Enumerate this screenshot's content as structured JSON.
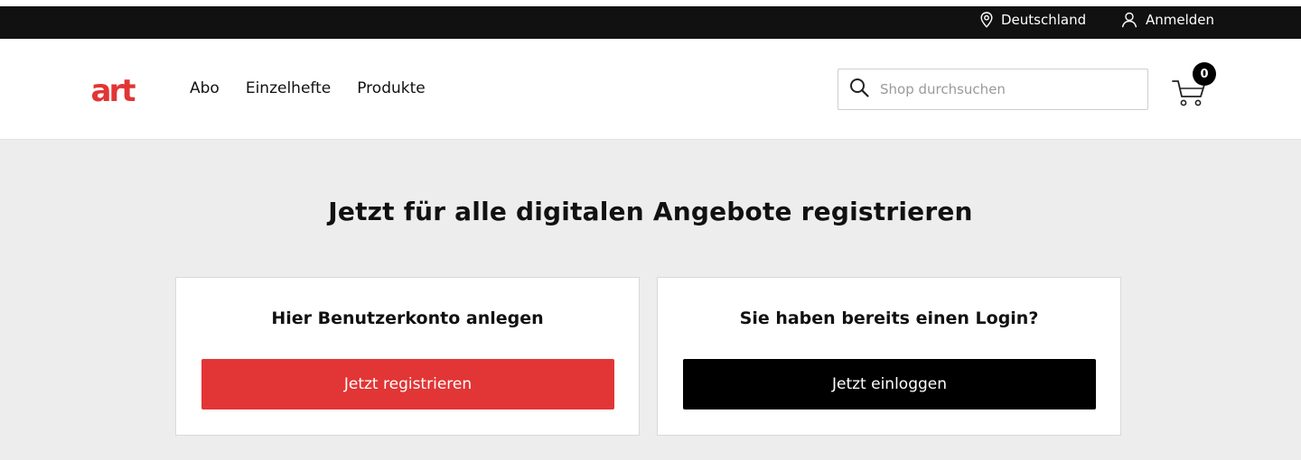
{
  "topbar": {
    "location_label": "Deutschland",
    "login_label": "Anmelden"
  },
  "header": {
    "logo_text": "art",
    "nav": [
      "Abo",
      "Einzelhefte",
      "Produkte"
    ],
    "search_placeholder": "Shop durchsuchen",
    "cart_count": "0"
  },
  "main": {
    "headline": "Jetzt für alle digitalen Angebote registrieren",
    "register_card": {
      "title": "Hier Benutzerkonto anlegen",
      "button": "Jetzt registrieren"
    },
    "login_card": {
      "title": "Sie haben bereits einen Login?",
      "button": "Jetzt einloggen"
    }
  },
  "colors": {
    "brand_red": "#e23535",
    "topbar": "#111111",
    "background": "#ededed"
  }
}
